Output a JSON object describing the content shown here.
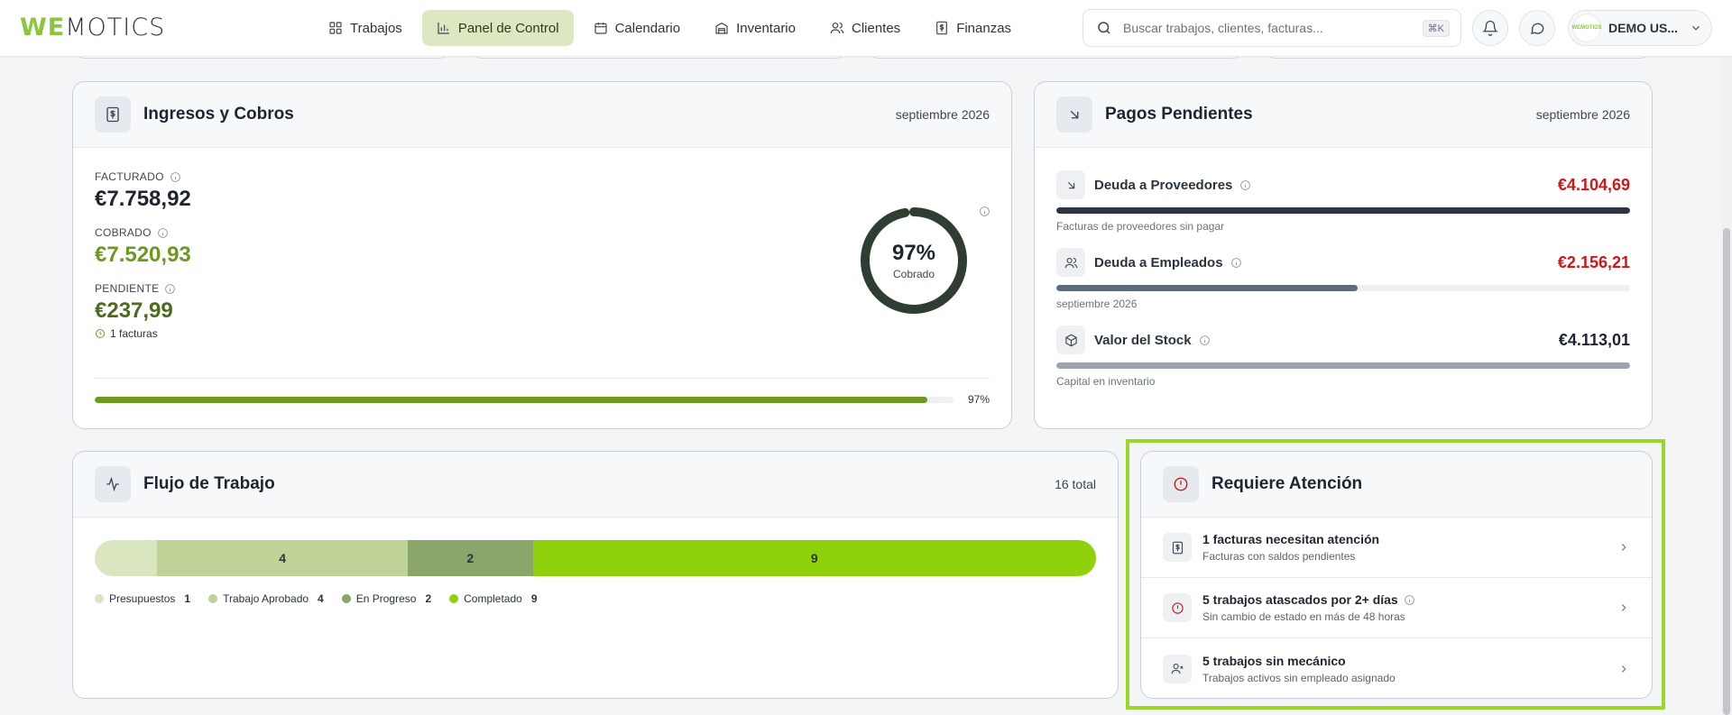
{
  "header": {
    "logo_we": "WE",
    "logo_rest": "MOTICS",
    "nav": [
      {
        "label": "Trabajos",
        "icon": "grid-icon"
      },
      {
        "label": "Panel de Control",
        "icon": "bar-chart-icon"
      },
      {
        "label": "Calendario",
        "icon": "calendar-icon"
      },
      {
        "label": "Inventario",
        "icon": "warehouse-icon"
      },
      {
        "label": "Clientes",
        "icon": "users-icon"
      },
      {
        "label": "Finanzas",
        "icon": "dollar-doc-icon"
      }
    ],
    "active_nav": "Panel de Control",
    "search_placeholder": "Buscar trabajos, clientes, facturas...",
    "search_shortcut": "⌘K",
    "user_name": "DEMO US...",
    "avatar_text": "WEMOTICS"
  },
  "ingresos": {
    "title": "Ingresos y Cobros",
    "period": "septiembre 2026",
    "facturado_label": "FACTURADO",
    "facturado_value": "€7.758,92",
    "cobrado_label": "COBRADO",
    "cobrado_value": "€7.520,93",
    "pendiente_label": "PENDIENTE",
    "pendiente_value": "€237,99",
    "facturas_note": "1 facturas",
    "ring_percent_text": "97%",
    "ring_label": "Cobrado",
    "ring_fraction": 0.97,
    "progress_text": "97%",
    "progress_fraction": 0.97,
    "colors": {
      "cobrado": "#6b9a1f",
      "pendiente": "#4d6b1c",
      "ring": "#2f3d33",
      "bar": "#6b9a1f"
    }
  },
  "pagos": {
    "title": "Pagos Pendientes",
    "period": "septiembre 2026",
    "rows": [
      {
        "label": "Deuda a Proveedores",
        "amount": "€4.104,69",
        "sub": "Facturas de proveedores sin pagar",
        "fill": 1.0,
        "color": "#2b3440",
        "amount_color": "#d0161b",
        "icon": "arrow-down-right-icon"
      },
      {
        "label": "Deuda a Empleados",
        "amount": "€2.156,21",
        "sub": "septiembre 2026",
        "fill": 0.525,
        "color": "#5f6b7a",
        "amount_color": "#d0161b",
        "icon": "users-icon"
      },
      {
        "label": "Valor del Stock",
        "amount": "€4.113,01",
        "sub": "Capital en inventario",
        "fill": 1.0,
        "color": "#9aa3af",
        "amount_color": "#1f2430",
        "icon": "box-icon"
      }
    ]
  },
  "flujo": {
    "title": "Flujo de Trabajo",
    "total": "16 total",
    "segments": [
      {
        "label": "Presupuestos",
        "count": 1,
        "color": "#d9e6bf"
      },
      {
        "label": "Trabajo Aprobado",
        "count": 4,
        "color": "#bfd398"
      },
      {
        "label": "En Progreso",
        "count": 2,
        "color": "#8aa66a"
      },
      {
        "label": "Completado",
        "count": 9,
        "color": "#8fd10a"
      }
    ]
  },
  "atencion": {
    "title": "Requiere Atención",
    "rows": [
      {
        "title": "1 facturas necesitan atención",
        "sub": "Facturas con saldos pendientes",
        "icon": "dollar-doc-icon"
      },
      {
        "title": "5 trabajos atascados por 2+ días",
        "sub": "Sin cambio de estado en más de 48 horas",
        "icon": "alert-circle-icon"
      },
      {
        "title": "5 trabajos sin mecánico",
        "sub": "Trabajos activos sin empleado asignado",
        "icon": "user-x-icon"
      }
    ],
    "accent": "#d0161b",
    "highlight_color": "#9bd62b"
  }
}
